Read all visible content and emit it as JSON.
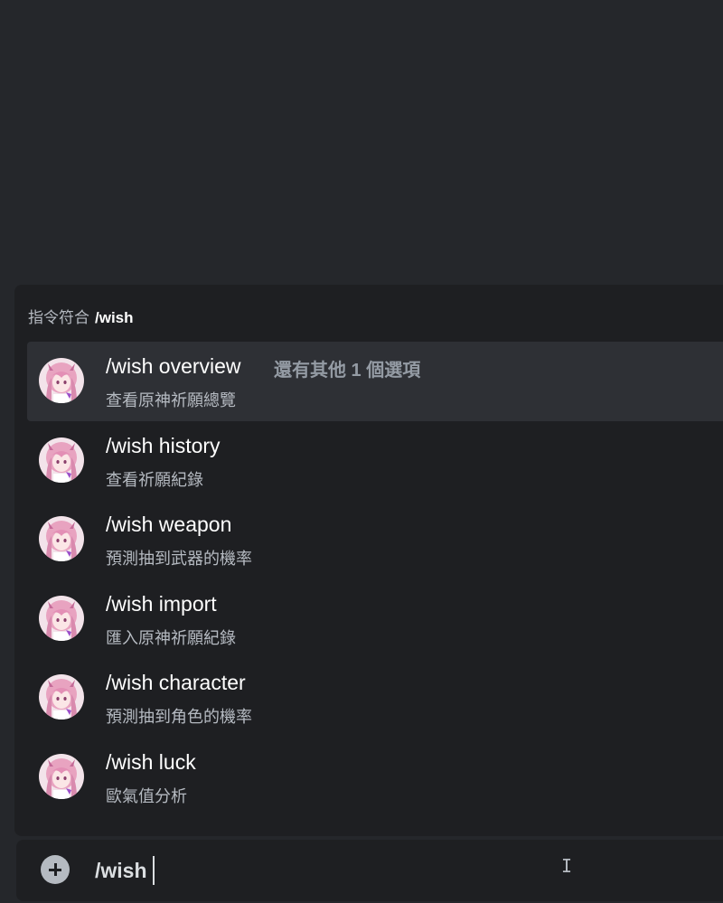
{
  "popup": {
    "header_label": "指令符合",
    "header_query": "/wish"
  },
  "commands": [
    {
      "name": "/wish overview",
      "extra": "還有其他 1 個選項",
      "description": "查看原神祈願總覽",
      "selected": true
    },
    {
      "name": "/wish history",
      "description": "查看祈願紀錄"
    },
    {
      "name": "/wish weapon",
      "description": "預測抽到武器的機率"
    },
    {
      "name": "/wish import",
      "description": "匯入原神祈願紀錄"
    },
    {
      "name": "/wish character",
      "description": "預測抽到角色的機率"
    },
    {
      "name": "/wish luck",
      "description": "歐氣值分析"
    }
  ],
  "input": {
    "value": "/wish"
  },
  "colors": {
    "background": "#25272b",
    "popup": "#1e1f22",
    "selected_row": "#2e3035",
    "avatar_pink": "#e8a3c0"
  }
}
